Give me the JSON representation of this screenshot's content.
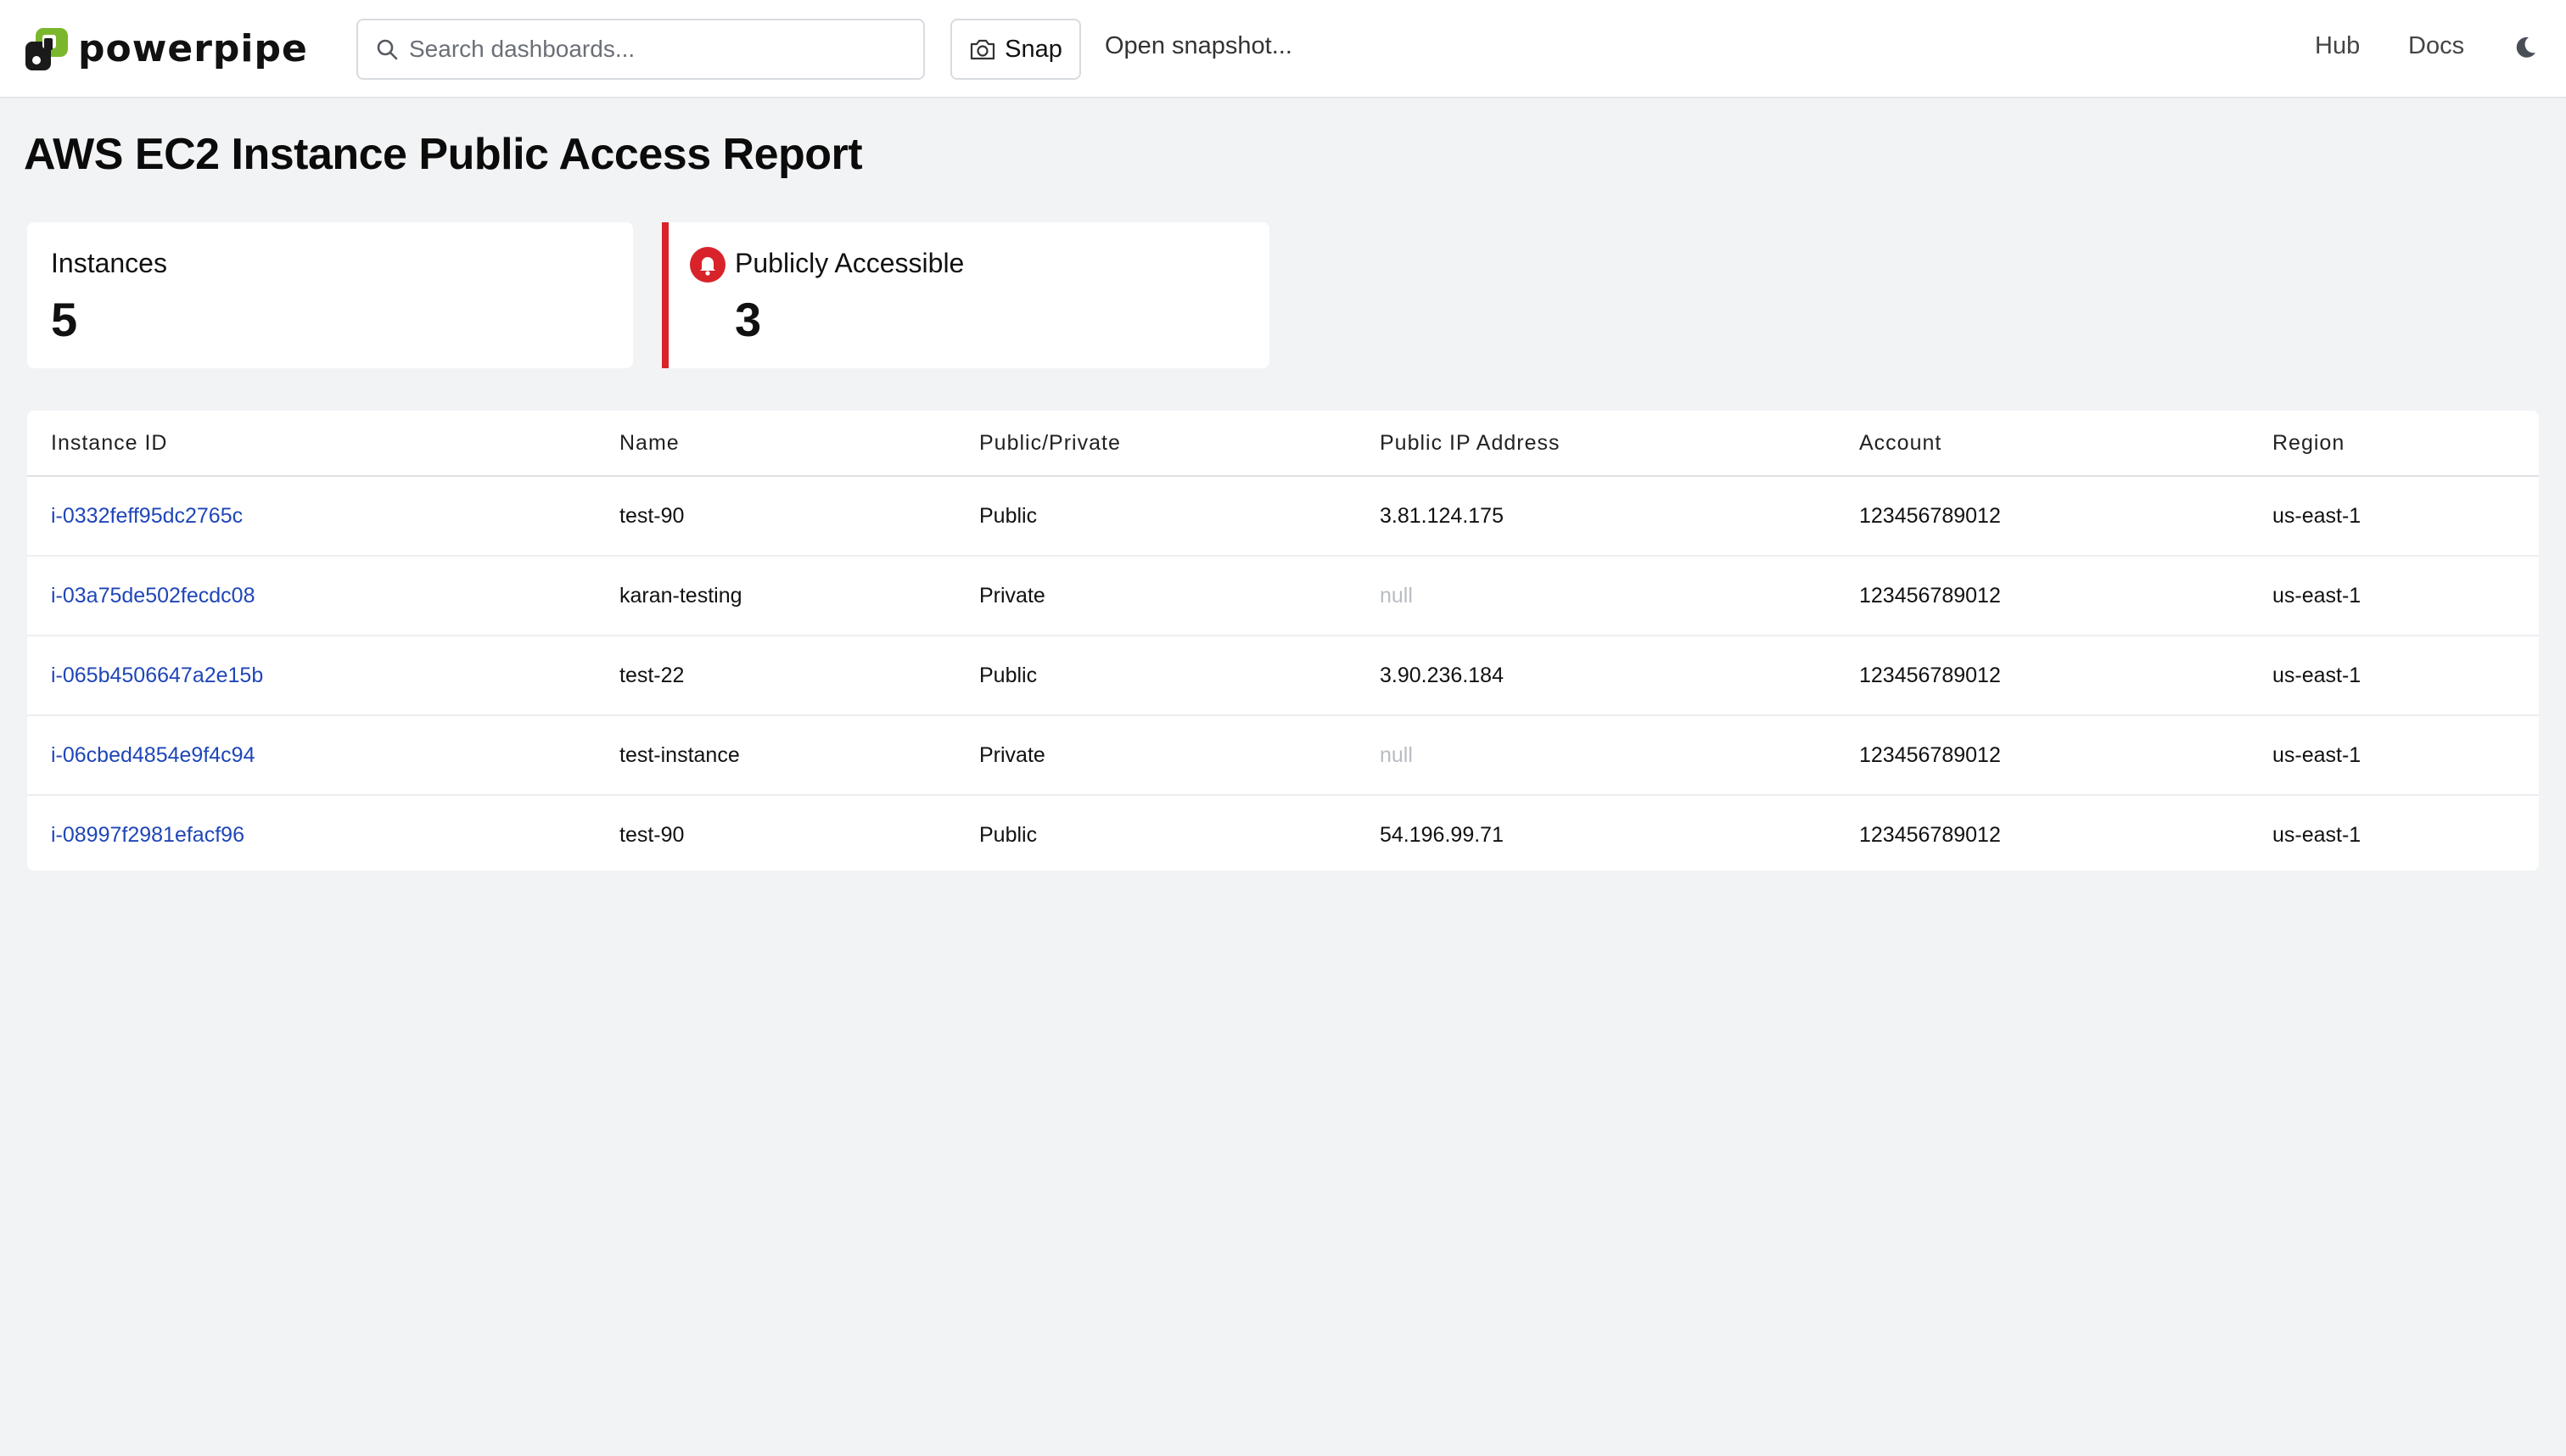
{
  "app": {
    "logo_text": "powerpipe",
    "search_placeholder": "Search dashboards...",
    "snap_label": "Snap",
    "open_snapshot_label": "Open snapshot...",
    "nav": {
      "hub": "Hub",
      "docs": "Docs"
    },
    "colors": {
      "logo_green": "#7bb72d",
      "alert_red": "#d8232a",
      "link_blue": "#1f46b8"
    }
  },
  "dashboard": {
    "title": "AWS EC2 Instance Public Access Report",
    "cards": {
      "instances": {
        "label": "Instances",
        "value": "5"
      },
      "public": {
        "label": "Publicly Accessible",
        "value": "3",
        "icon": "alert-bell-icon"
      }
    },
    "table": {
      "columns": [
        "Instance ID",
        "Name",
        "Public/Private",
        "Public IP Address",
        "Account",
        "Region"
      ],
      "rows": [
        {
          "id": "i-0332feff95dc2765c",
          "name": "test-90",
          "access": "Public",
          "ip": "3.81.124.175",
          "account": "123456789012",
          "region": "us-east-1"
        },
        {
          "id": "i-03a75de502fecdc08",
          "name": "karan-testing",
          "access": "Private",
          "ip": "null",
          "account": "123456789012",
          "region": "us-east-1"
        },
        {
          "id": "i-065b4506647a2e15b",
          "name": "test-22",
          "access": "Public",
          "ip": "3.90.236.184",
          "account": "123456789012",
          "region": "us-east-1"
        },
        {
          "id": "i-06cbed4854e9f4c94",
          "name": "test-instance",
          "access": "Private",
          "ip": "null",
          "account": "123456789012",
          "region": "us-east-1"
        },
        {
          "id": "i-08997f2981efacf96",
          "name": "test-90",
          "access": "Public",
          "ip": "54.196.99.71",
          "account": "123456789012",
          "region": "us-east-1"
        }
      ]
    }
  }
}
